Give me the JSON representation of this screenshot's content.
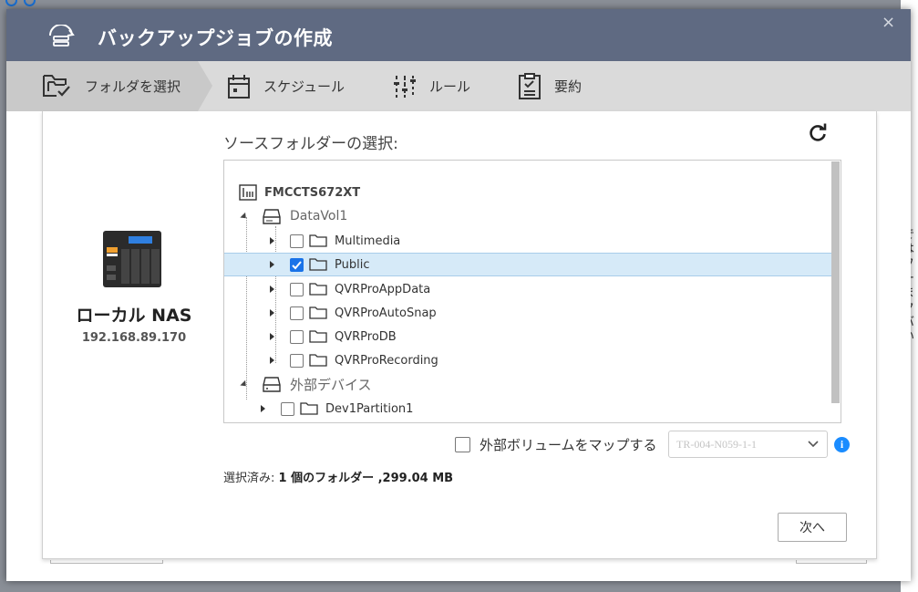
{
  "dialog": {
    "title": "バックアップジョブの作成",
    "close_label": "×"
  },
  "steps": [
    {
      "label": "フォルダを選択",
      "icon": "folder-select-icon",
      "active": true
    },
    {
      "label": "スケジュール",
      "icon": "calendar-icon",
      "active": false
    },
    {
      "label": "ルール",
      "icon": "sliders-icon",
      "active": false
    },
    {
      "label": "要約",
      "icon": "clipboard-icon",
      "active": false
    }
  ],
  "source": {
    "device_name": "ローカル NAS",
    "device_ip": "192.168.89.170",
    "section_label": "ソースフォルダーの選択:"
  },
  "tree": {
    "root": "FMCCTS672XT",
    "volume": "DataVol1",
    "folders": [
      {
        "name": "Multimedia",
        "checked": false
      },
      {
        "name": "Public",
        "checked": true
      },
      {
        "name": "QVRProAppData",
        "checked": false
      },
      {
        "name": "QVRProAutoSnap",
        "checked": false
      },
      {
        "name": "QVRProDB",
        "checked": false
      },
      {
        "name": "QVRProRecording",
        "checked": false
      }
    ],
    "external_label": "外部デバイス",
    "external_folders": [
      {
        "name": "Dev1Partition1",
        "checked": false
      }
    ]
  },
  "map": {
    "label": "外部ボリュームをマップする",
    "select_value": "TR-004-N059-1-1",
    "info_label": "i"
  },
  "summary": {
    "prefix": "選択済み: ",
    "value": "1 個のフォルダー ,299.04 MB"
  },
  "buttons": {
    "next": "次へ"
  },
  "background": {
    "right_text": [
      "で",
      "は",
      "フ",
      "ー",
      "ま",
      "ク",
      "バ",
      "い"
    ]
  },
  "colors": {
    "header": "#5f6a82",
    "accent": "#1a73e8",
    "selected_row": "#d6eaf8"
  }
}
